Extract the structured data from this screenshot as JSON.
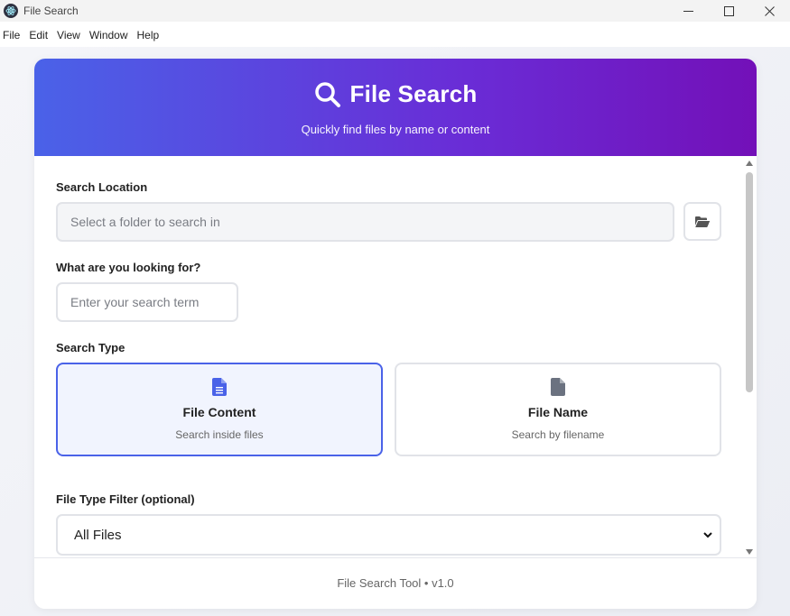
{
  "window": {
    "title": "File Search",
    "controls": {
      "minimize": "—",
      "maximize": "☐",
      "close": "✕"
    }
  },
  "menu": {
    "items": [
      {
        "label": "File"
      },
      {
        "label": "Edit"
      },
      {
        "label": "View"
      },
      {
        "label": "Window"
      },
      {
        "label": "Help"
      }
    ]
  },
  "header": {
    "title": "File Search",
    "subtitle": "Quickly find files by name or content",
    "icon": "search-icon"
  },
  "form": {
    "location": {
      "label": "Search Location",
      "placeholder": "Select a folder to search in",
      "browse_icon": "folder-open-icon"
    },
    "term": {
      "label": "What are you looking for?",
      "placeholder": "Enter your search term"
    },
    "search_type": {
      "label": "Search Type",
      "options": [
        {
          "title": "File Content",
          "subtitle": "Search inside files",
          "icon": "file-text-icon",
          "selected": true
        },
        {
          "title": "File Name",
          "subtitle": "Search by filename",
          "icon": "file-icon",
          "selected": false
        }
      ]
    },
    "file_type": {
      "label": "File Type Filter (optional)",
      "selected": "All Files"
    }
  },
  "footer": {
    "text": "File Search Tool • v1.0"
  },
  "colors": {
    "accent": "#4a62e8",
    "gradient_start": "#4a62e8",
    "gradient_end": "#7310b8"
  }
}
